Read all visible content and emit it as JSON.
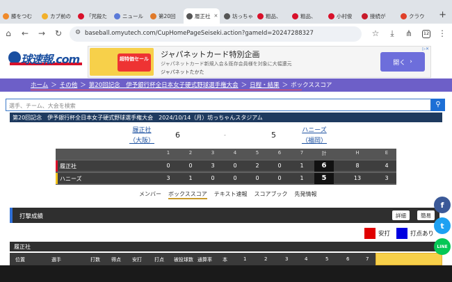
{
  "tabs": [
    {
      "label": "膝をつむ",
      "icon": "page-icon",
      "color": "#f08a2a"
    },
    {
      "label": "カブ前の",
      "icon": "sun-icon",
      "color": "#f2b02a"
    },
    {
      "label": "「咒殺た",
      "icon": "yahoo-icon",
      "color": "#d8102a"
    },
    {
      "label": "ニュール",
      "icon": "doc-icon",
      "color": "#5a7ad8"
    },
    {
      "label": "第20回",
      "icon": "page-icon",
      "color": "#e07a2a"
    },
    {
      "label": "履正社",
      "icon": "globe-icon",
      "color": "#555555",
      "active": true
    },
    {
      "label": "坊っちゃ",
      "icon": "globe-icon",
      "color": "#555555"
    },
    {
      "label": "粗品、",
      "icon": "yahoo-icon",
      "color": "#d8102a"
    },
    {
      "label": "粗品、",
      "icon": "yahoo-icon",
      "color": "#d8102a"
    },
    {
      "label": "小村俊",
      "icon": "circle-icon",
      "color": "#d8102a"
    },
    {
      "label": "接続が",
      "icon": "bookmark-icon",
      "color": "#c81a2a"
    },
    {
      "label": "クラウ",
      "icon": "bolt-icon",
      "color": "#e0402a"
    }
  ],
  "address": {
    "url": "baseball.omyutech.com/CupHomePageSeiseki.action?gameId=20247288327",
    "tab_count": "12"
  },
  "ad": {
    "title": "ジャパネットカード特別企画",
    "desc": "ジャパネットカード新規入会＆既存会員様を対象に大幅還元",
    "advertiser": "ジャパネットたかた",
    "button": "開く",
    "image_text": "超特価セール"
  },
  "breadcrumbs": [
    "ホーム",
    "その他",
    "第20回記念　伊予銀行杯全日本女子硬式野球選手権大会",
    "日程・結果",
    "ボックススコア"
  ],
  "search": {
    "placeholder": "選手、チーム、大会を検索"
  },
  "game": {
    "banner": "第20回記念　伊予銀行杯全日本女子硬式野球選手権大会　2024/10/14（月）坊っちゃんスタジアム",
    "home": {
      "name": "履正社",
      "region": "（大阪）",
      "score": "6"
    },
    "away": {
      "name": "ハニーズ",
      "region": "（福岡）",
      "score": "5"
    },
    "dash": "-"
  },
  "scoreboard": {
    "headers": [
      "1",
      "2",
      "3",
      "4",
      "5",
      "6",
      "7",
      "計",
      "H",
      "E"
    ],
    "rows": [
      {
        "team": "履正社",
        "color": "#d8102a",
        "cells": [
          "0",
          "0",
          "3",
          "0",
          "2",
          "0",
          "1",
          "6",
          "8",
          "4"
        ]
      },
      {
        "team": "ハニーズ",
        "color": "#f2c21a",
        "cells": [
          "3",
          "1",
          "0",
          "0",
          "0",
          "0",
          "1",
          "5",
          "13",
          "3"
        ]
      }
    ]
  },
  "subnav": [
    "メンバー",
    "ボックススコア",
    "テキスト速報",
    "スコアブック",
    "先発情報"
  ],
  "batting": {
    "title": "打撃成績",
    "buttons": [
      "詳細",
      "簡易"
    ],
    "legend": [
      {
        "label": "安打",
        "color": "#e00000"
      },
      {
        "label": "打点あり",
        "color": "#0000e0"
      }
    ],
    "team": "履正社",
    "columns": [
      "位置",
      "選手",
      "打数",
      "得点",
      "安打",
      "打点",
      "被投球数",
      "通算率",
      "本",
      "1",
      "2",
      "3",
      "4",
      "5",
      "6",
      "7"
    ]
  },
  "social": [
    {
      "name": "facebook-icon",
      "glyph": "f",
      "color": "#3b5998"
    },
    {
      "name": "twitter-icon",
      "glyph": "t",
      "color": "#1da1f2"
    },
    {
      "name": "line-icon",
      "glyph": "LINE",
      "color": "#06c755"
    }
  ]
}
